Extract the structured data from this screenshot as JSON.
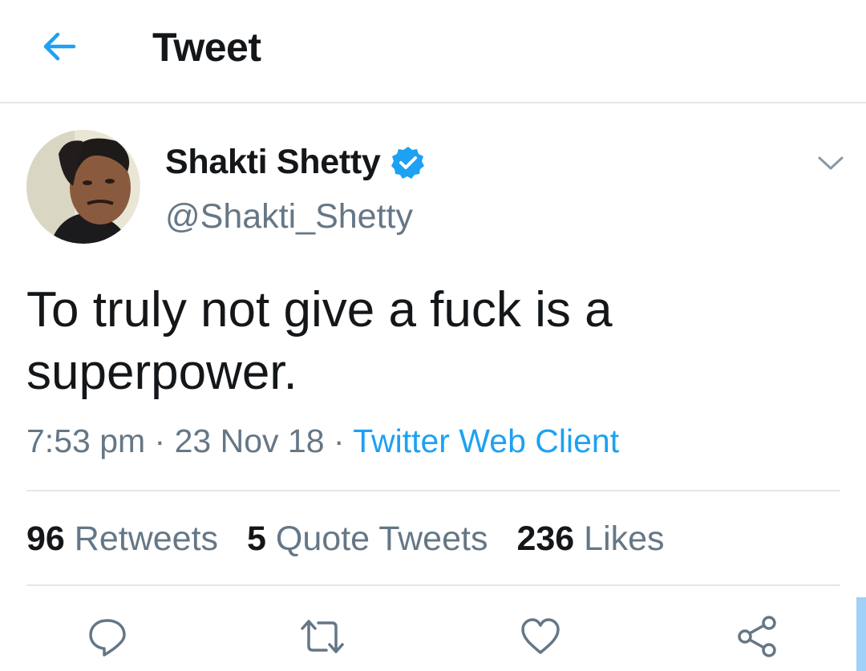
{
  "header": {
    "title": "Tweet",
    "back_icon": "arrow-left-icon"
  },
  "author": {
    "name": "Shakti Shetty",
    "handle": "@Shakti_Shetty",
    "verified": true
  },
  "tweet": {
    "text": "To truly not give a fuck is a superpower.",
    "time": "7:53 pm",
    "separator": " · ",
    "date": "23 Nov 18",
    "source": "Twitter Web Client"
  },
  "stats": {
    "retweets_count": "96",
    "retweets_label": "Retweets",
    "quotes_count": "5",
    "quotes_label": "Quote Tweets",
    "likes_count": "236",
    "likes_label": "Likes"
  },
  "actions": [
    "reply-icon",
    "retweet-icon",
    "like-icon",
    "share-icon"
  ],
  "colors": {
    "accent": "#1da1f2",
    "text": "#14171a",
    "secondary": "#657786",
    "divider": "#e1e8ed"
  }
}
